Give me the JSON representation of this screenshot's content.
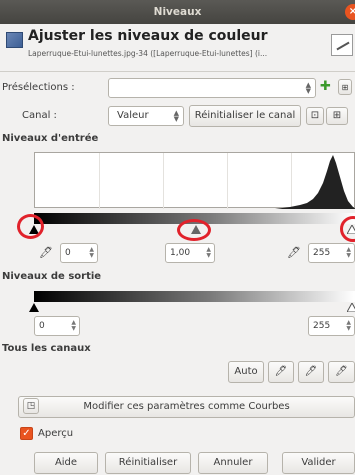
{
  "window": {
    "title": "Niveaux",
    "close_glyph": "×"
  },
  "header": {
    "title": "Ajuster les niveaux de couleur",
    "subtitle": "Laperruque-Etui-lunettes.jpg-34 ([Laperruque-Etui-lunettes] (i..."
  },
  "presets": {
    "label": "Présélections :",
    "value": "",
    "add_glyph": "✚"
  },
  "channel": {
    "label": "Canal :",
    "value": "Valeur",
    "reset_label": "Réinitialiser le canal"
  },
  "input_levels": {
    "title": "Niveaux d'entrée",
    "black_value": "0",
    "gamma_value": "1,00",
    "white_value": "255"
  },
  "output_levels": {
    "title": "Niveaux de sortie",
    "black_value": "0",
    "white_value": "255"
  },
  "all_channels": {
    "title": "Tous les canaux",
    "auto_label": "Auto"
  },
  "curves": {
    "label": "Modifier ces paramètres comme Courbes"
  },
  "preview": {
    "label": "Aperçu",
    "checked": true
  },
  "buttons": {
    "help": "Aide",
    "reset": "Réinitialiser",
    "cancel": "Annuler",
    "ok": "Valider"
  },
  "colors": {
    "accent": "#e95420",
    "annotation_circle": "#e1222b"
  }
}
